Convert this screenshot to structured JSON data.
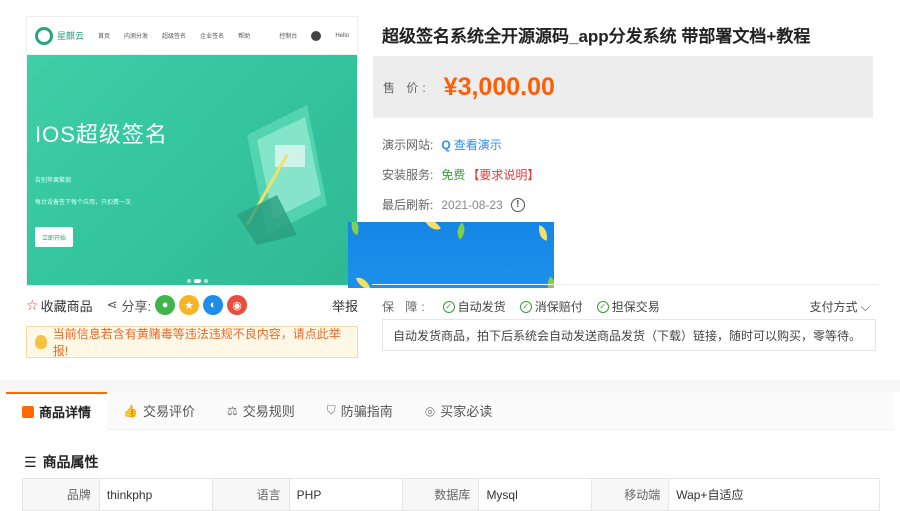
{
  "product": {
    "title": "超级签名系统全开源源码_app分发系统 带部署文档+教程",
    "price_label": "售 价:",
    "price": "¥3,000.00",
    "demo_label": "演示网站:",
    "demo_link": "查看演示",
    "service_label": "安装服务:",
    "service_value": "免费",
    "service_req": "【要求说明】",
    "refresh_label": "最后刷新:",
    "refresh_date": "2021-08-23",
    "info_icon": "!"
  },
  "gallery": {
    "logo_text": "星麒云",
    "nav": [
      "首页",
      "内测分发",
      "超级签名",
      "企业签名",
      "帮助"
    ],
    "right_nav": [
      "控制台",
      "Hello"
    ],
    "hero_title": "IOS超级签名",
    "hero_sub1": "告别苹果繁琐",
    "hero_sub2": "每台设备签下每个应用，只扣费一次",
    "hero_btn": "立即开始"
  },
  "actions": {
    "fav": "收藏商品",
    "share": "分享:",
    "report": "举报",
    "share_icons": [
      {
        "icon": "wechat-icon",
        "color": "#3fb54a",
        "glyph": "●"
      },
      {
        "icon": "qzone-icon",
        "color": "#f5b524",
        "glyph": "★"
      },
      {
        "icon": "qq-icon",
        "color": "#1d8de8",
        "glyph": "◐"
      },
      {
        "icon": "weibo-icon",
        "color": "#e94e3c",
        "glyph": "◉"
      }
    ]
  },
  "notice": "当前信息若含有黄赌毒等违法违规不良内容，请点此举报!",
  "guarantee": {
    "label": "保 障:",
    "items": [
      "自动发货",
      "消保赔付",
      "担保交易"
    ],
    "pay": "支付方式",
    "auto_text": "自动发货商品，拍下后系统会自动发送商品发货（下载）链接，随时可以购买，零等待。"
  },
  "tabs": [
    {
      "label": "商品详情",
      "icon": "detail-icon",
      "active": true
    },
    {
      "label": "交易评价",
      "icon": "thumb-icon",
      "glyph": "👍"
    },
    {
      "label": "交易规则",
      "icon": "scale-icon",
      "glyph": "⚖"
    },
    {
      "label": "防骗指南",
      "icon": "shield-icon",
      "glyph": "⛉"
    },
    {
      "label": "买家必读",
      "icon": "target-icon",
      "glyph": "◎"
    }
  ],
  "attributes": {
    "heading": "商品属性",
    "rows": [
      {
        "k": "品牌",
        "v": "thinkphp"
      },
      {
        "k": "语言",
        "v": "PHP"
      },
      {
        "k": "数据库",
        "v": "Mysql"
      },
      {
        "k": "移动端",
        "v": "Wap+自适应"
      }
    ]
  },
  "colors": {
    "accent": "#ff5d06",
    "link": "#2d8cf0",
    "tab_active": "#ff6a00"
  }
}
